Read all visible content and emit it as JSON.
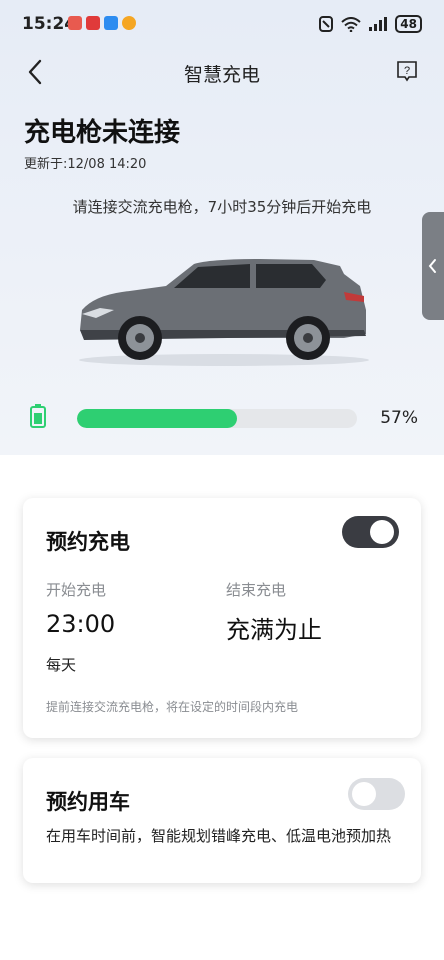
{
  "status_bar": {
    "time": "15:24",
    "battery": "48",
    "app_icons": [
      {
        "name": "app-notification-icon-1",
        "color": "#e85a4f"
      },
      {
        "name": "app-notification-icon-2",
        "color": "#e03a3a"
      },
      {
        "name": "app-notification-icon-3",
        "color": "#2d8cf0"
      },
      {
        "name": "weibo-icon",
        "color": "#f5a623"
      }
    ],
    "icons": [
      "nfc-icon",
      "wifi-icon",
      "signal-icon",
      "battery-icon"
    ]
  },
  "nav": {
    "title": "智慧充电",
    "back_icon": "chevron-left-icon",
    "help_icon": "help-icon"
  },
  "status": {
    "headline": "充电枪未连接",
    "updated": "更新于:12/08 14:20",
    "hint": "请连接交流充电枪，7小时35分钟后开始充电",
    "battery_percent_label": "57%",
    "battery_level": 0.57,
    "accent_color": "#2ecf72"
  },
  "schedule_charge": {
    "title": "预约充电",
    "enabled": true,
    "start_label": "开始充电",
    "start_value": "23:00",
    "end_label": "结束充电",
    "end_value": "充满为止",
    "repeat": "每天",
    "note": "提前连接交流充电枪，将在设定的时间段内充电"
  },
  "schedule_use": {
    "title": "预约用车",
    "enabled": false,
    "description": "在用车时间前，智能规划错峰充电、低温电池预加热"
  }
}
